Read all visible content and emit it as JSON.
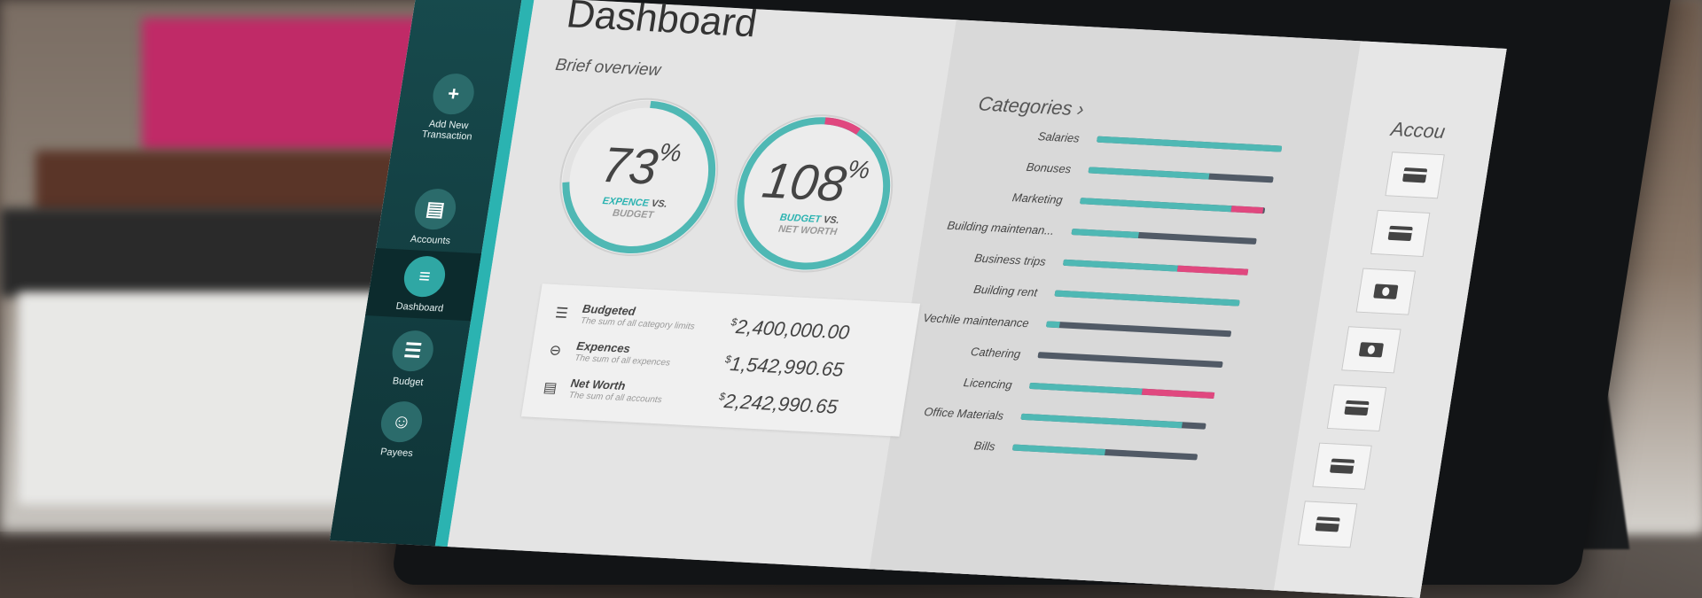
{
  "sidebar": {
    "items": [
      {
        "label": "Add New Transaction",
        "icon": "plus-icon"
      },
      {
        "label": "Accounts",
        "icon": "folder-icon"
      },
      {
        "label": "Dashboard",
        "icon": "sliders-icon"
      },
      {
        "label": "Budget",
        "icon": "stack-icon"
      },
      {
        "label": "Payees",
        "icon": "people-icon"
      }
    ],
    "accent_color": "#2bb3b1",
    "background_color": "#174a4d"
  },
  "main": {
    "title": "Dashboard",
    "subtitle": "Brief overview",
    "gauges": [
      {
        "value": 73,
        "display": "73",
        "unit": "%",
        "caption_highlight": "EXPENCE",
        "caption_vs": "VS.",
        "caption_rest": "BUDGET"
      },
      {
        "value": 108,
        "display": "108",
        "unit": "%",
        "caption_highlight": "BUDGET",
        "caption_vs": "VS.",
        "caption_rest": "NET WORTH"
      }
    ],
    "summary": [
      {
        "label": "Budgeted",
        "desc": "The sum of all category limits",
        "currency": "$",
        "value": "2,400,000.00"
      },
      {
        "label": "Expences",
        "desc": "The sum of all expences",
        "currency": "$",
        "value": "1,542,990.65"
      },
      {
        "label": "Net Worth",
        "desc": "The sum of all accounts",
        "currency": "$",
        "value": "2,242,990.65"
      }
    ]
  },
  "categories": {
    "title": "Categories",
    "colors": {
      "spent": "#4fb8b4",
      "remaining": "#515a66",
      "over": "#e0487f"
    },
    "items": [
      {
        "label": "Salaries",
        "spent": 1.0,
        "over": 0
      },
      {
        "label": "Bonuses",
        "spent": 0.65,
        "over": 0
      },
      {
        "label": "Marketing",
        "spent": 0.82,
        "over": 0.17
      },
      {
        "label": "Building maintenan...",
        "spent": 0.36,
        "over": 0
      },
      {
        "label": "Business trips",
        "spent": 0.62,
        "over": 0.38
      },
      {
        "label": "Building rent",
        "spent": 1.0,
        "over": 0
      },
      {
        "label": "Vechile maintenance",
        "spent": 0.07,
        "over": 0
      },
      {
        "label": "Cathering",
        "spent": 0.0,
        "over": 0
      },
      {
        "label": "Licencing",
        "spent": 0.61,
        "over": 0.39
      },
      {
        "label": "Office Materials",
        "spent": 0.87,
        "over": 0
      },
      {
        "label": "Bills",
        "spent": 0.5,
        "over": 0
      }
    ]
  },
  "accounts": {
    "title": "Accou",
    "cards": [
      "card-icon",
      "card-icon",
      "cash-icon",
      "cash-icon",
      "card-icon",
      "card-icon",
      "card-icon"
    ]
  }
}
